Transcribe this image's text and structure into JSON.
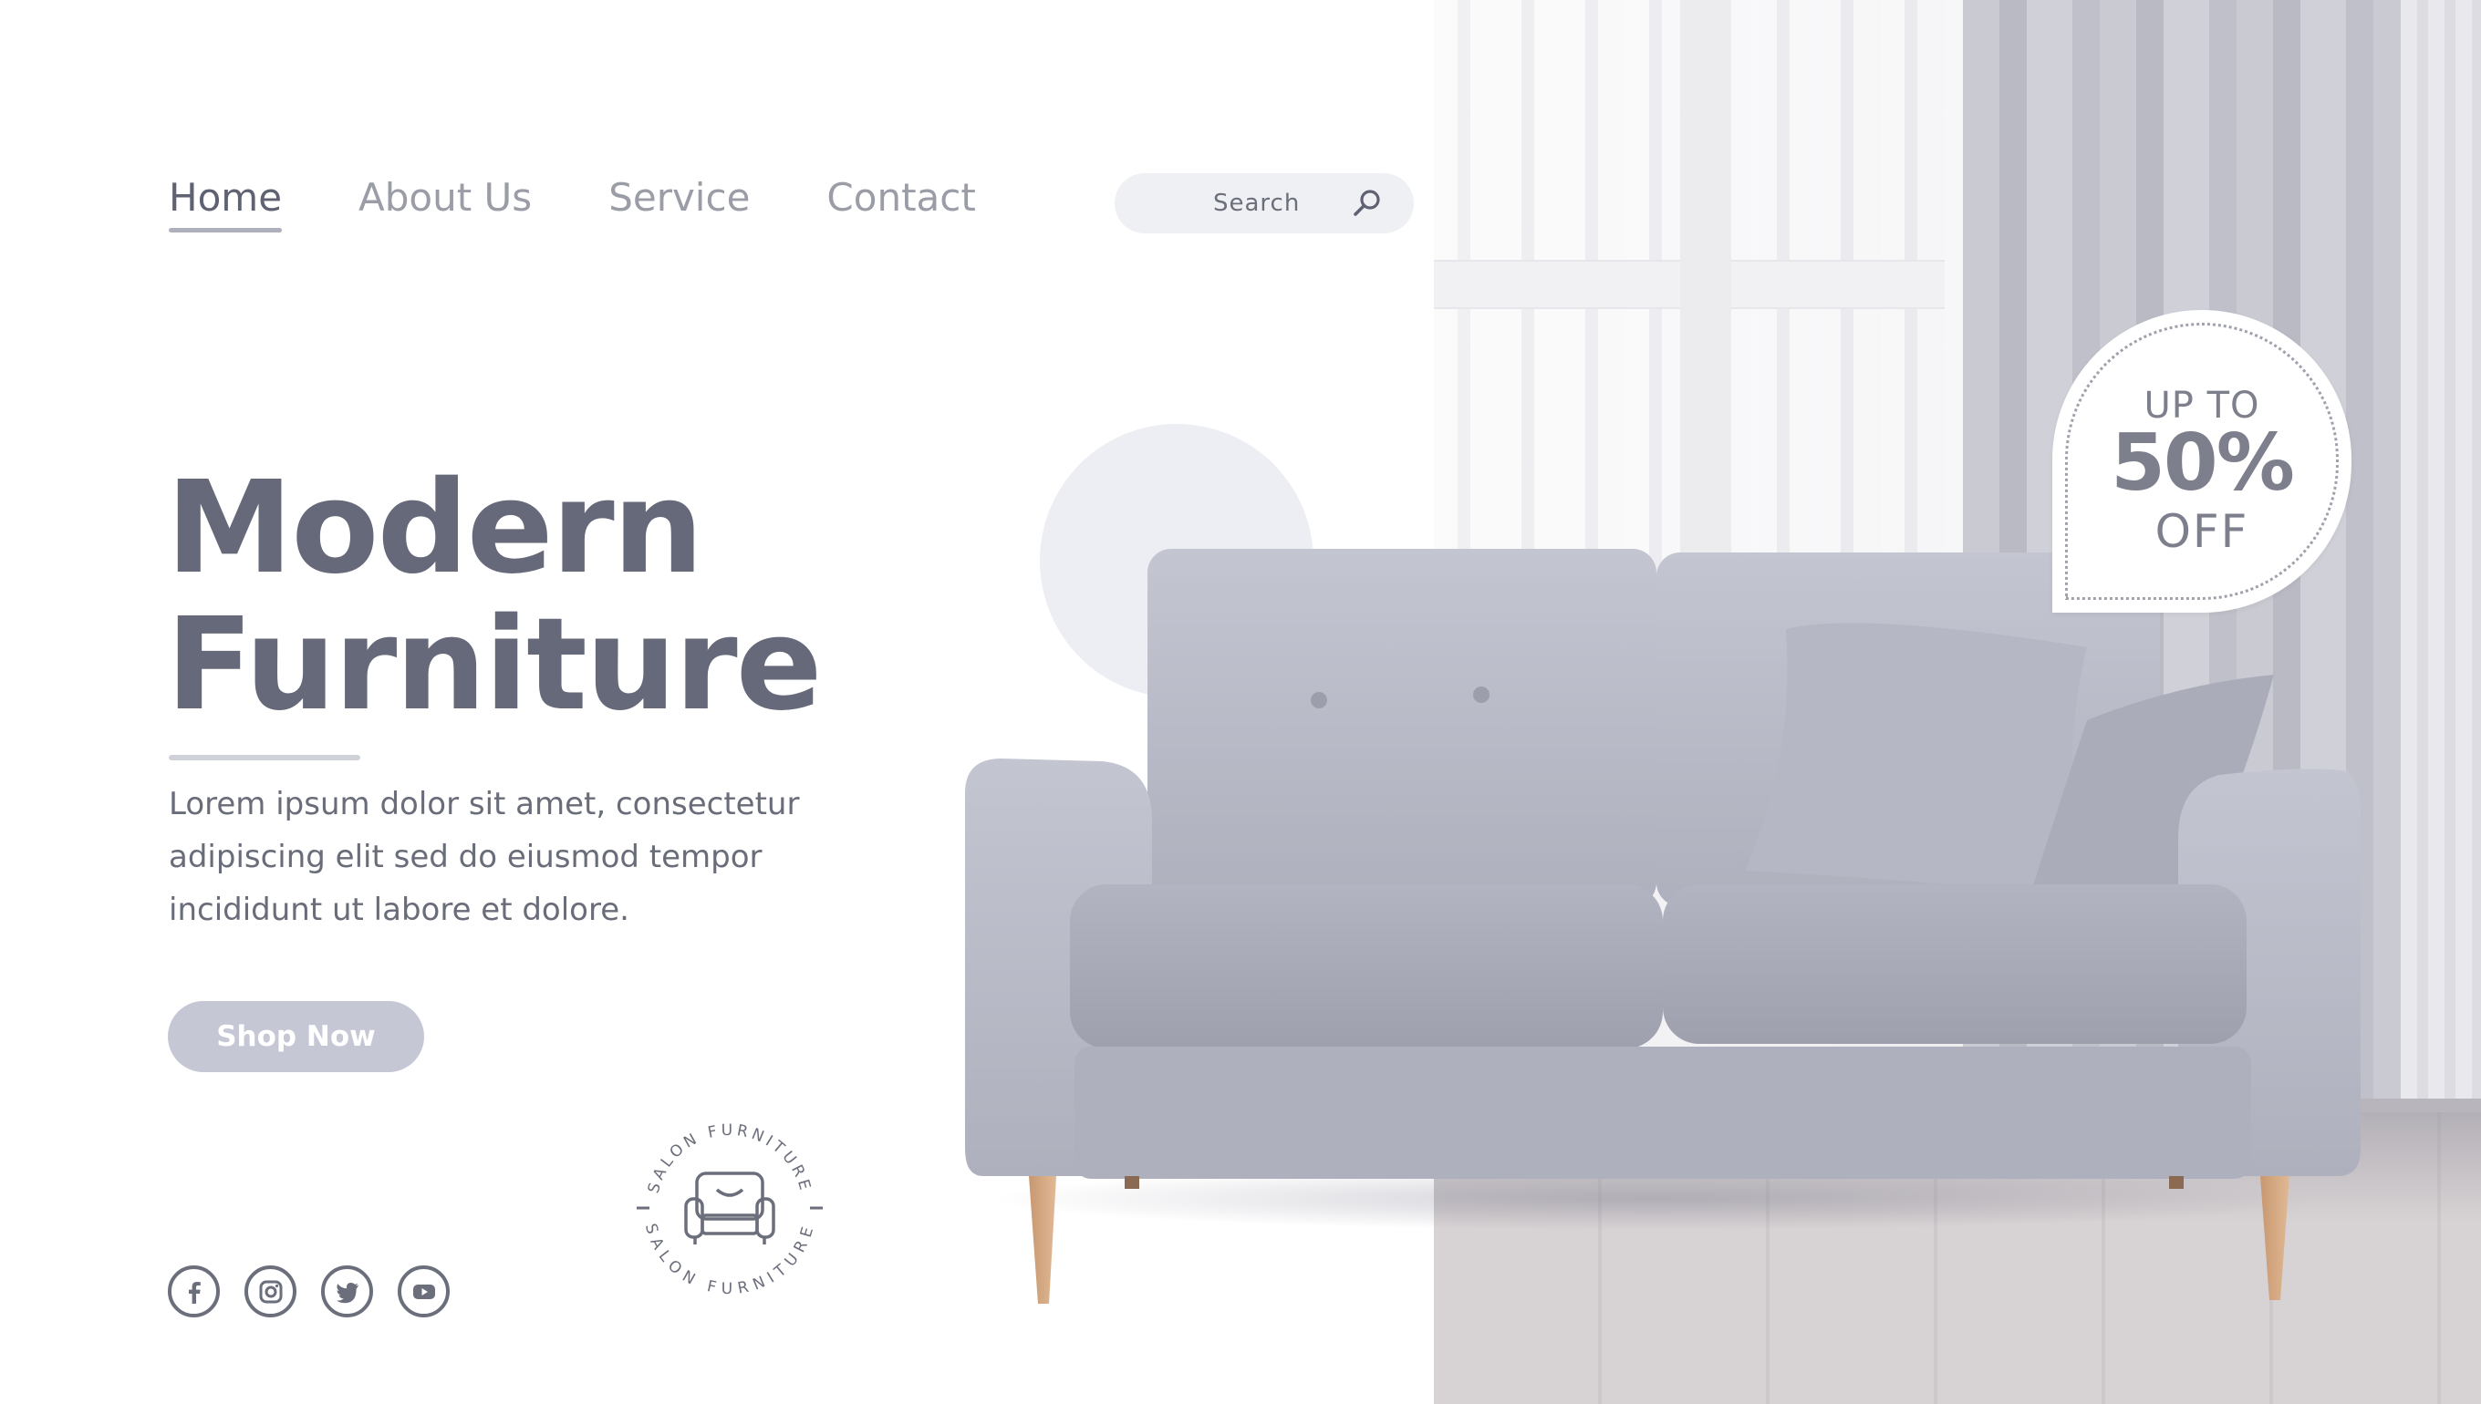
{
  "nav": {
    "items": [
      {
        "label": "Home",
        "active": true
      },
      {
        "label": "About Us",
        "active": false
      },
      {
        "label": "Service",
        "active": false
      },
      {
        "label": "Contact",
        "active": false
      }
    ]
  },
  "search": {
    "placeholder": "Search",
    "icon": "search-icon"
  },
  "hero": {
    "title_line1": "Modern",
    "title_line2": "Furniture",
    "description": "Lorem ipsum dolor sit amet, consectetur adipiscing elit sed do eiusmod tempor incididunt ut labore et dolore.",
    "cta_label": "Shop Now"
  },
  "discount": {
    "line1": "UP TO",
    "line2": "50%",
    "line3": "OFF"
  },
  "logo": {
    "text": "SALON FURNITURE"
  },
  "socials": [
    {
      "icon": "facebook-icon"
    },
    {
      "icon": "instagram-icon"
    },
    {
      "icon": "twitter-icon"
    },
    {
      "icon": "youtube-icon"
    }
  ],
  "colors": {
    "primary_text": "#666979",
    "nav_inactive": "#9a9ca6",
    "button_bg": "#c5c8d4",
    "search_bg": "#eff0f3",
    "sofa": "#b9bbc8"
  }
}
